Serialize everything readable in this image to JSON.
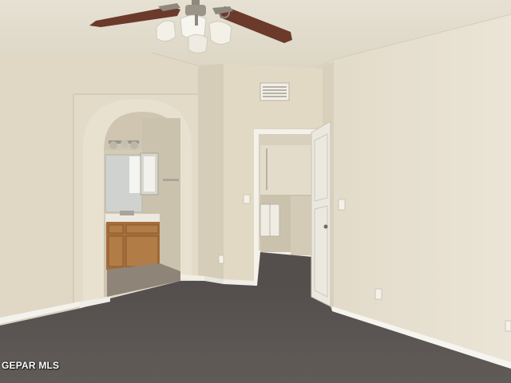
{
  "photo": {
    "watermark": "GEPAR MLS"
  },
  "palette": {
    "ceiling": "#e4decf",
    "wall_left": "#e0d8c5",
    "wall_center": "#ddd4bf",
    "wall_right": "#e5dece",
    "trim": "#f4f2ec",
    "carpet": "#5a5552",
    "fan_blade": "#6b3a2a",
    "cabinet": "#a56f3c",
    "door": "#ece9e0"
  }
}
